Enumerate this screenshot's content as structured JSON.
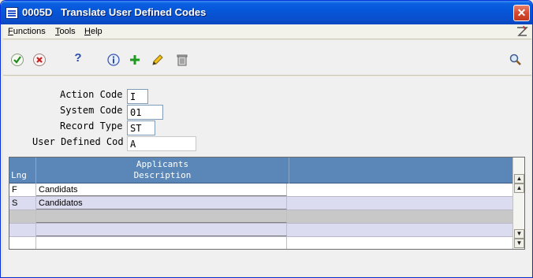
{
  "window": {
    "title": "0005D   Translate User Defined Codes",
    "close_symbol": "✕"
  },
  "menu": {
    "items": [
      {
        "label": "Functions",
        "underline": "F",
        "rest": "unctions"
      },
      {
        "label": "Tools",
        "underline": "T",
        "rest": "ools"
      },
      {
        "label": "Help",
        "underline": "H",
        "rest": "elp"
      }
    ]
  },
  "toolbar": {
    "icons": [
      "ok-check-icon",
      "cancel-x-icon",
      "help-question-icon",
      "information-icon",
      "add-plus-icon",
      "edit-pencil-icon",
      "delete-trash-icon",
      "search-magnifier-icon"
    ],
    "help_glyph": "?",
    "plus_glyph": "+"
  },
  "form": {
    "action_code_label": "Action Code",
    "action_code_value": "I",
    "system_code_label": "System Code",
    "system_code_value": "01",
    "record_type_label": "Record Type",
    "record_type_value": "ST",
    "udc_label": "User Defined Cod",
    "udc_value": "A"
  },
  "grid": {
    "header": {
      "lng": "Lng",
      "desc_line1": "Applicants",
      "desc_line2": "Description"
    },
    "rows": [
      {
        "lng": "F",
        "description": "Candidats"
      },
      {
        "lng": "S",
        "description": "Candidatos"
      },
      {
        "lng": "",
        "description": ""
      },
      {
        "lng": "",
        "description": ""
      },
      {
        "lng": "",
        "description": ""
      }
    ],
    "scroll_up": "▲",
    "scroll_down": "▼"
  },
  "colors": {
    "grid_header": "#5a87b8",
    "row_lavender": "#dcdcf0",
    "row_grey": "#c8c8c8",
    "titlebar": "#0656d8"
  }
}
